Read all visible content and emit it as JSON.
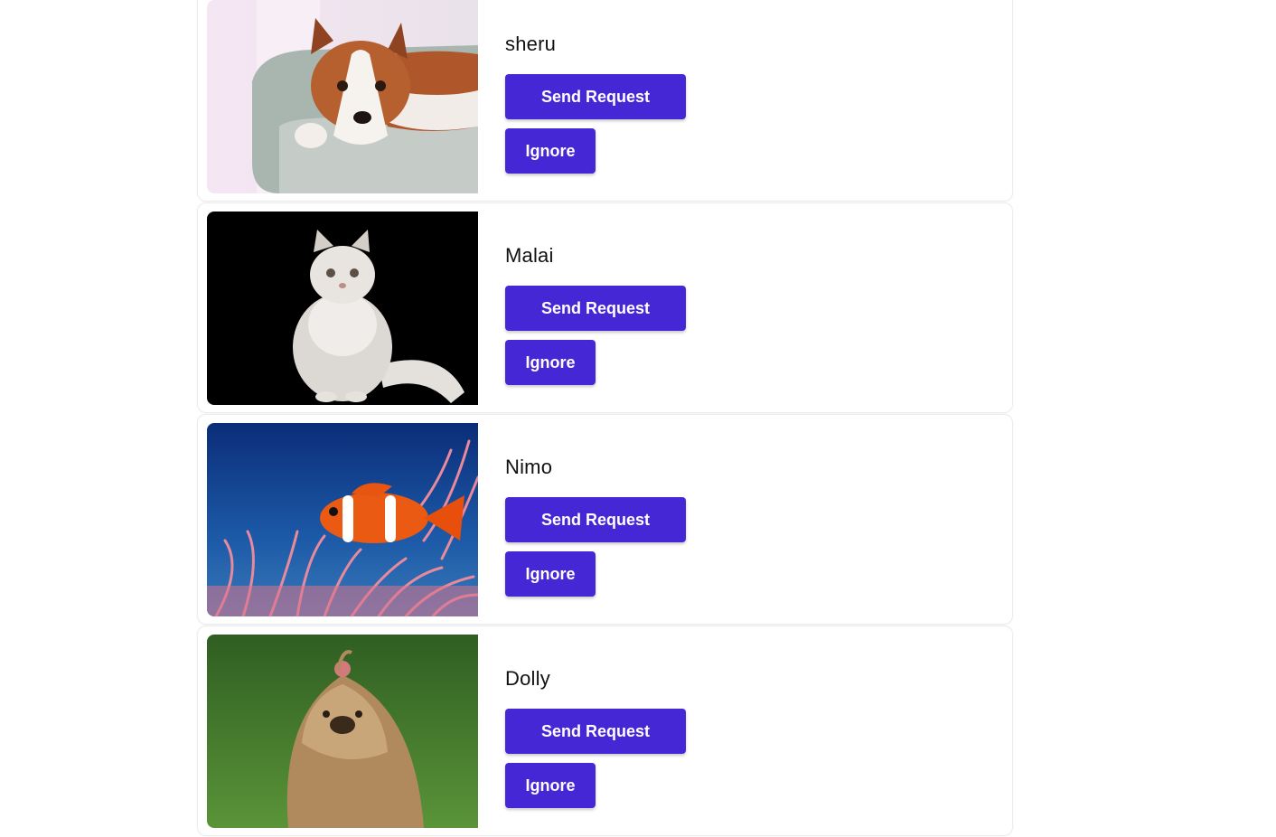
{
  "colors": {
    "button_bg": "#4527d6",
    "button_text": "#ffffff",
    "card_border": "#ececec",
    "name_text": "#111111"
  },
  "pets": [
    {
      "name": "sheru",
      "photo_icon": "dog-photo",
      "send_label": "Send Request",
      "ignore_label": "Ignore"
    },
    {
      "name": "Malai",
      "photo_icon": "cat-photo",
      "send_label": "Send Request",
      "ignore_label": "Ignore"
    },
    {
      "name": "Nimo",
      "photo_icon": "clownfish-photo",
      "send_label": "Send Request",
      "ignore_label": "Ignore"
    },
    {
      "name": "Dolly",
      "photo_icon": "shih-tzu-photo",
      "send_label": "Send Request",
      "ignore_label": "Ignore"
    }
  ]
}
